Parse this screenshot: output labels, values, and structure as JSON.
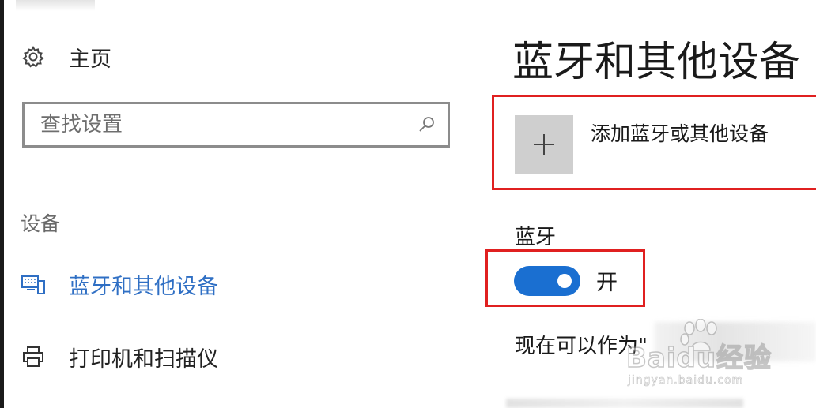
{
  "sidebar": {
    "home_label": "主页",
    "search_placeholder": "查找设置",
    "section_label": "设备",
    "items": [
      {
        "label": "蓝牙和其他设备",
        "icon": "bluetooth-devices-icon",
        "active": true
      },
      {
        "label": "打印机和扫描仪",
        "icon": "printer-icon",
        "active": false
      }
    ]
  },
  "main": {
    "title": "蓝牙和其他设备",
    "add_device_label": "添加蓝牙或其他设备",
    "bluetooth_heading": "蓝牙",
    "bluetooth_toggle": {
      "state_label": "开",
      "on": true
    },
    "discoverable_text": "现在可以作为\""
  },
  "watermark": {
    "text": "Baidu经验",
    "sub": "jingyan.baidu.com"
  },
  "colors": {
    "accent": "#1a6fd1",
    "active_text": "#2f6fc4",
    "highlight_border": "#e02020"
  }
}
